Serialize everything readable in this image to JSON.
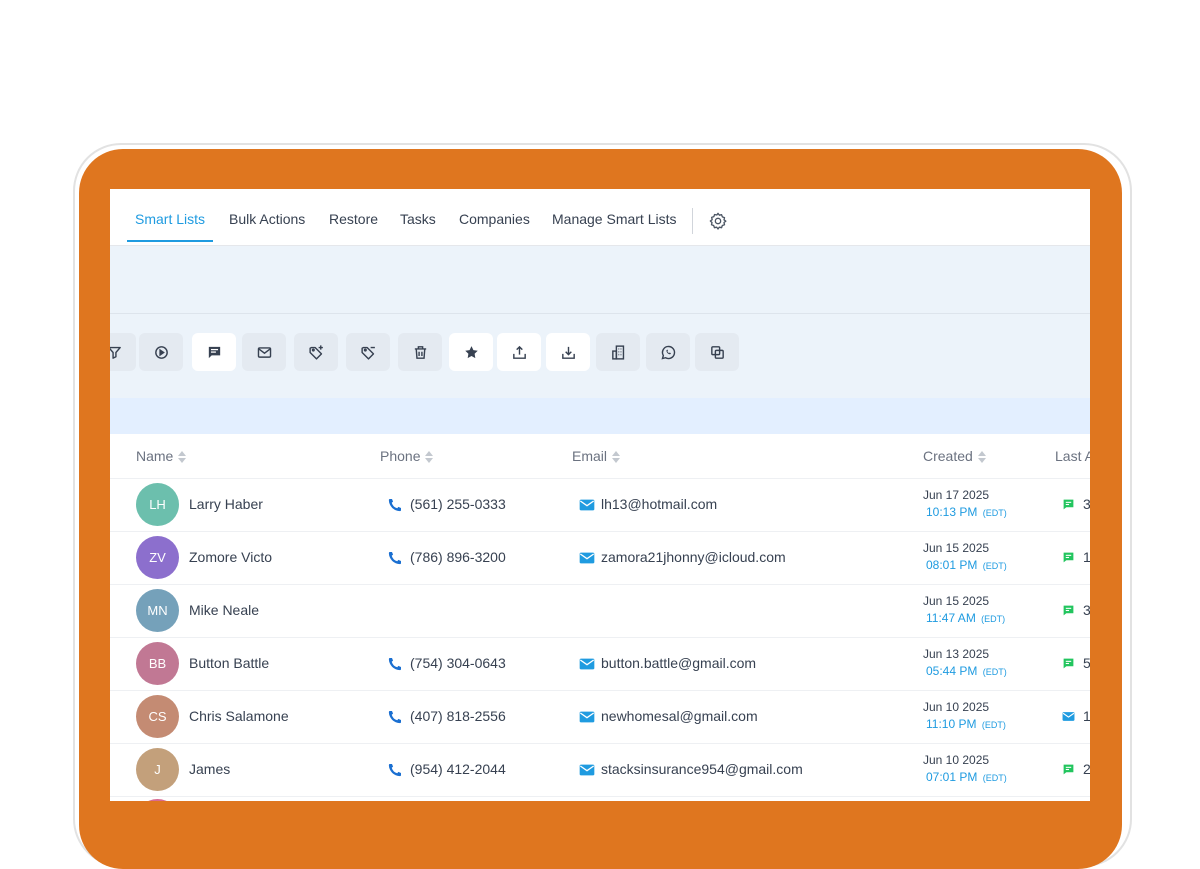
{
  "nav": {
    "tabs": [
      {
        "label": "Smart Lists"
      },
      {
        "label": "Bulk Actions"
      },
      {
        "label": "Restore"
      },
      {
        "label": "Tasks"
      },
      {
        "label": "Companies"
      },
      {
        "label": "Manage Smart Lists"
      }
    ],
    "active_tab": "Smart Lists",
    "settings_icon": "gear-icon"
  },
  "toolbar": {
    "buttons": [
      {
        "icon": "filter-icon"
      },
      {
        "icon": "automation-icon"
      },
      {
        "icon": "sms-icon"
      },
      {
        "icon": "email-icon"
      },
      {
        "icon": "add-tag-icon"
      },
      {
        "icon": "remove-tag-icon"
      },
      {
        "icon": "delete-icon"
      },
      {
        "icon": "star-icon"
      },
      {
        "icon": "export-icon"
      },
      {
        "icon": "import-icon"
      },
      {
        "icon": "company-icon"
      },
      {
        "icon": "whatsapp-icon"
      },
      {
        "icon": "merge-icon"
      }
    ]
  },
  "table": {
    "columns": [
      "Name",
      "Phone",
      "Email",
      "Created",
      "Last A"
    ],
    "rows": [
      {
        "initials": "LH",
        "avatar_color": "#6cbfad",
        "name": "Larry Haber",
        "phone": "(561) 255-0333",
        "email": "lh13@hotmail.com",
        "created_date": "Jun 17 2025",
        "created_time": "10:13 PM",
        "tz": "(EDT)",
        "last_activity_icon": "sms-icon",
        "last_activity_count": "3"
      },
      {
        "initials": "ZV",
        "avatar_color": "#8c6fcd",
        "name": "Zomore Victo",
        "phone": "(786) 896-3200",
        "email": "zamora21jhonny@icloud.com",
        "created_date": "Jun 15 2025",
        "created_time": "08:01 PM",
        "tz": "(EDT)",
        "last_activity_icon": "sms-icon",
        "last_activity_count": "1"
      },
      {
        "initials": "MN",
        "avatar_color": "#75a1ba",
        "name": "Mike Neale",
        "phone": "",
        "email": "",
        "created_date": "Jun 15 2025",
        "created_time": "11:47 AM",
        "tz": "(EDT)",
        "last_activity_icon": "sms-icon",
        "last_activity_count": "3"
      },
      {
        "initials": "BB",
        "avatar_color": "#c17894",
        "name": "Button Battle",
        "phone": "(754) 304-0643",
        "email": "button.battle@gmail.com",
        "created_date": "Jun 13 2025",
        "created_time": "05:44 PM",
        "tz": "(EDT)",
        "last_activity_icon": "sms-icon",
        "last_activity_count": "5"
      },
      {
        "initials": "CS",
        "avatar_color": "#c48b73",
        "name": "Chris Salamone",
        "phone": "(407) 818-2556",
        "email": "newhomesal@gmail.com",
        "created_date": "Jun 10 2025",
        "created_time": "11:10 PM",
        "tz": "(EDT)",
        "last_activity_icon": "email-icon",
        "last_activity_count": "1"
      },
      {
        "initials": "J",
        "avatar_color": "#c3a07b",
        "name": "James",
        "phone": "(954) 412-2044",
        "email": "stacksinsurance954@gmail.com",
        "created_date": "Jun 10 2025",
        "created_time": "07:01 PM",
        "tz": "(EDT)",
        "last_activity_icon": "sms-icon",
        "last_activity_count": "2"
      }
    ]
  },
  "colors": {
    "accent": "#1f9be0",
    "device_frame": "#df761f",
    "sms_green": "#22c55e",
    "mail_blue": "#1f9be0"
  }
}
